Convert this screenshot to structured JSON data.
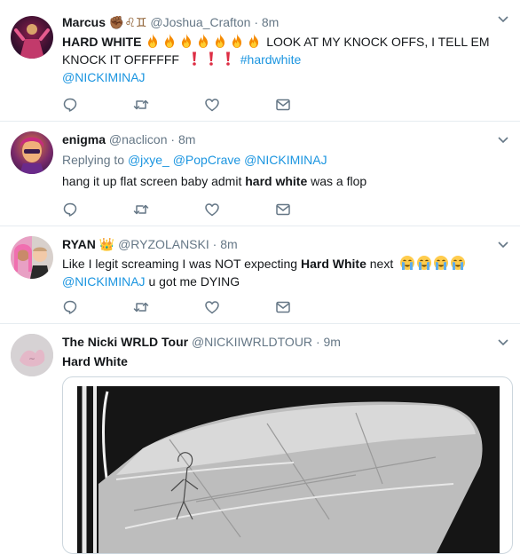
{
  "tweets": [
    {
      "name": "Marcus",
      "name_emojis": "✊🏾♌♊",
      "handle": "@Joshua_Crafton",
      "dot": "·",
      "time": "8m",
      "line1_bold": "HARD WHITE",
      "line1_rest": "LOOK AT MY KNOCK OFFS, I TELL EM",
      "line2_text": "KNOCK IT OFFFFFF",
      "hashtag": "#hardwhite",
      "mention": "@NICKIMINAJ",
      "fire_emoji": "🔥",
      "exclaim_emoji": "❗"
    },
    {
      "name": "enigma",
      "handle": "@naclicon",
      "dot": "·",
      "time": "8m",
      "reply_prefix": "Replying to",
      "reply_handles": "@jxye_ @PopCrave @NICKIMINAJ",
      "text_pre": "hang it up flat screen baby admit ",
      "text_bold": "hard white",
      "text_post": " was a flop"
    },
    {
      "name": "RYAN",
      "name_emoji": "👑",
      "handle": "@RYZOLANSKI",
      "dot": "·",
      "time": "8m",
      "text_pre": "Like I legit screaming I was NOT expecting ",
      "text_bold": "Hard White",
      "text_post": " next",
      "mention": "@NICKIMINAJ",
      "text2": " u got me DYING",
      "cry_emoji": "😭"
    },
    {
      "name": "The Nicki WRLD Tour",
      "handle": "@NICKIIWRLDTOUR",
      "dot": "·",
      "time": "9m",
      "text_bold": "Hard White"
    }
  ],
  "icons": {
    "reply": "reply-icon",
    "retweet": "retweet-icon",
    "like": "like-icon",
    "dm": "direct-message-icon",
    "caret": "chevron-down-icon"
  },
  "colors": {
    "link": "#1b95e0",
    "muted": "#657786",
    "divider": "#e6ecf0",
    "icon": "#657786"
  }
}
